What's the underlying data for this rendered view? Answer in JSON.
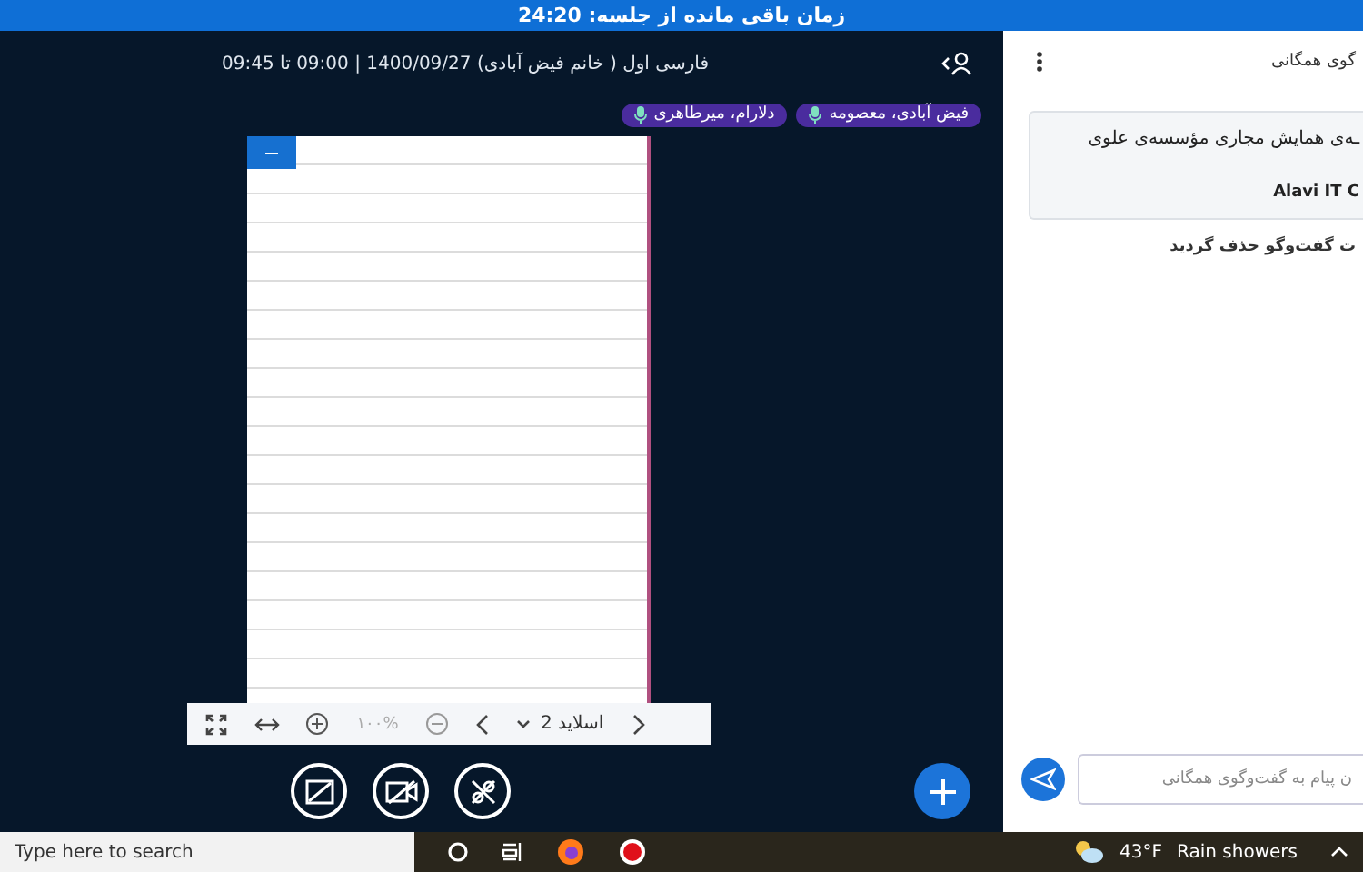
{
  "banner": {
    "text": "زمان باقی مانده از جلسه: 24:20"
  },
  "header": {
    "title": "فارسی اول ( خانم فیض آبادی) 1400/09/27 | 09:00 تا 09:45"
  },
  "talkers": [
    {
      "name": "فیض آبادی، معصومه"
    },
    {
      "name": "دلارام، میرطاهری"
    }
  ],
  "slide_toolbar": {
    "zoom": "۱۰۰%",
    "slide": "اسلاید 2"
  },
  "chat": {
    "title": "گوی همگانی",
    "welcome": [
      "ـه‌ی همایش مجاری مؤسسه‌ی علوی",
      "Alavi IT C"
    ],
    "notice": "ت گفت‌وگو حذف گردید",
    "input": {
      "placeholder": "ن پیام به گفت‌وگوی همگانی"
    }
  },
  "taskbar": {
    "search": {
      "placeholder": "Type here to search"
    },
    "temperature": "43°F",
    "weather": "Rain showers"
  }
}
